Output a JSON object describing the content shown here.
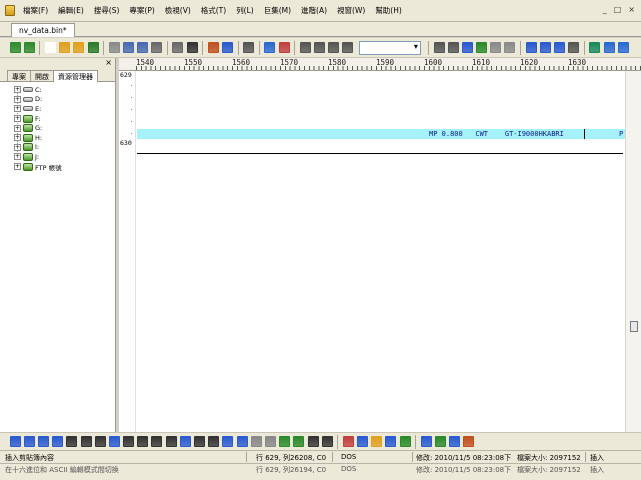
{
  "menubar": {
    "items": [
      "檔案(F)",
      "編輯(E)",
      "搜尋(S)",
      "專案(P)",
      "檢視(V)",
      "格式(T)",
      "列(L)",
      "巨集(M)",
      "進階(A)",
      "視窗(W)",
      "幫助(H)"
    ],
    "controls": [
      "_",
      "□",
      "×"
    ]
  },
  "tabs": {
    "document": "nv_data.bin*"
  },
  "left_panel": {
    "close_label": "×",
    "tabs": [
      "專案",
      "開啟",
      "資源管理器"
    ],
    "tree": [
      {
        "label": "C:",
        "icon": "drive-icon"
      },
      {
        "label": "D:",
        "icon": "drive-icon"
      },
      {
        "label": "E:",
        "icon": "drive-icon"
      },
      {
        "label": "F:",
        "icon": "network-drive-icon"
      },
      {
        "label": "G:",
        "icon": "network-drive-icon"
      },
      {
        "label": "H:",
        "icon": "network-drive-icon"
      },
      {
        "label": "I:",
        "icon": "network-drive-icon"
      },
      {
        "label": "J:",
        "icon": "network-drive-icon"
      },
      {
        "label": "FTP 帳號",
        "icon": "network-drive-icon"
      }
    ]
  },
  "ruler": {
    "labels": [
      "1540",
      "1550",
      "1560",
      "1570",
      "1580",
      "1590",
      "1600",
      "1610",
      "1620",
      "1630"
    ]
  },
  "editor": {
    "line_numbers": [
      "629",
      "630"
    ],
    "highlighted_text": "MP 0.800   CWT    GT-I9000HKABRI",
    "trailing_char": "P"
  },
  "toolbar_colors": {
    "top": [
      "#2e8b2e",
      "#2e8b2e",
      "#ffffff",
      "#e0a020",
      "#e0a020",
      "#2a7a2a",
      "#8a8a8a",
      "#4a6ab0",
      "#4a6ab0",
      "#6a6a6a",
      "#6a6a6a",
      "#333333",
      "#c05020",
      "#2a5ad0",
      "#555555",
      "#2a6ad0",
      "#c04040",
      "#555555",
      "#555555",
      "#555555",
      "#555555",
      "#555555",
      "#555555",
      "#2a5ad0",
      "#2a8a2a",
      "#8a8a8a",
      "#8a8a8a",
      "#2a5ad0",
      "#2a5ad0",
      "#2a5ad0",
      "#555555",
      "#1a8a5a",
      "#2a6ad0",
      "#2a6ad0"
    ],
    "bottom": [
      "#2a5ad0",
      "#2a5ad0",
      "#2a5ad0",
      "#2a5ad0",
      "#333333",
      "#333333",
      "#333333",
      "#2a5ad0",
      "#333333",
      "#333333",
      "#333333",
      "#333333",
      "#2a5ad0",
      "#333333",
      "#333333",
      "#2a5ad0",
      "#2a5ad0",
      "#888888",
      "#888888",
      "#2a8a2a",
      "#2a8a2a",
      "#333333",
      "#333333",
      "#c04040",
      "#2a5ad0",
      "#e0a020",
      "#2a5ad0",
      "#2a8a2a",
      "#2a5ad0",
      "#2a8a2a",
      "#2a5ad0",
      "#c05020"
    ]
  },
  "statusbar": {
    "hint": "插入剪貼簿內容",
    "position": "行 629, 列26208, C0",
    "encoding": "DOS",
    "modified": "修改: 2010/11/5 08:23:08下",
    "filesize": "檔案大小: 2097152",
    "mode": "插入"
  },
  "statusbar2": {
    "hint": "在十六進位和 ASCII 編輯模式間切換",
    "position": "行 629, 列26194, C0",
    "encoding": "DOS",
    "modified": "修改: 2010/11/5 08:23:08下",
    "filesize": "檔案大小: 2097152",
    "mode": "插入"
  }
}
